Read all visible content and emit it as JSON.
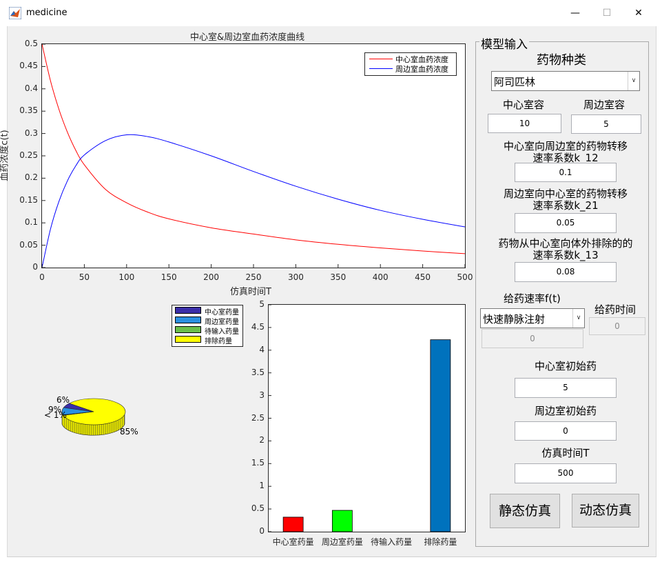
{
  "window": {
    "title": "medicine",
    "minimize_glyph": "—",
    "maximize_glyph": "☐",
    "close_glyph": "✕"
  },
  "concentration_chart": {
    "title": "中心室&周边室血药浓度曲线",
    "xlabel": "仿真时间T",
    "ylabel": "血药浓度c(t)",
    "xticks": [
      "0",
      "50",
      "100",
      "150",
      "200",
      "250",
      "300",
      "350",
      "400",
      "450",
      "500"
    ],
    "yticks": [
      "0",
      "0.05",
      "0.1",
      "0.15",
      "0.2",
      "0.25",
      "0.3",
      "0.35",
      "0.4",
      "0.45",
      "0.5"
    ],
    "legend": [
      "中心室血药浓度",
      "周边室血药浓度"
    ],
    "colors": [
      "#ff0000",
      "#0000ff"
    ]
  },
  "pie_chart": {
    "legend": [
      "中心室药量",
      "周边室药量",
      "待输入药量",
      "排除药量"
    ],
    "labels": [
      "6%",
      "9%",
      "< 1%",
      "85%"
    ],
    "colors": [
      "#3a2ea8",
      "#2a8fe0",
      "#6bbf4a",
      "#ffff00"
    ]
  },
  "bar_chart": {
    "categories": [
      "中心室药量",
      "周边室药量",
      "待输入药量",
      "排除药量"
    ],
    "yticks": [
      "0",
      "0.5",
      "1",
      "1.5",
      "2",
      "2.5",
      "3",
      "3.5",
      "4",
      "4.5",
      "5"
    ],
    "colors": [
      "#ff0000",
      "#00ff00",
      "#0000ff",
      "#0072bd"
    ]
  },
  "chart_data": [
    {
      "type": "line",
      "title": "中心室&周边室血药浓度曲线",
      "xlabel": "仿真时间T",
      "ylabel": "血药浓度c(t)",
      "xlim": [
        0,
        500
      ],
      "ylim": [
        0,
        0.5
      ],
      "x": [
        0,
        10,
        20,
        30,
        40,
        50,
        75,
        100,
        125,
        150,
        200,
        250,
        300,
        350,
        400,
        450,
        500
      ],
      "series": [
        {
          "name": "中心室血药浓度",
          "values": [
            0.5,
            0.418,
            0.354,
            0.303,
            0.262,
            0.23,
            0.175,
            0.145,
            0.124,
            0.109,
            0.089,
            0.075,
            0.062,
            0.052,
            0.044,
            0.037,
            0.031
          ]
        },
        {
          "name": "周边室血药浓度",
          "values": [
            0,
            0.086,
            0.148,
            0.194,
            0.228,
            0.252,
            0.284,
            0.297,
            0.293,
            0.281,
            0.25,
            0.215,
            0.182,
            0.153,
            0.128,
            0.108,
            0.091
          ]
        }
      ],
      "legend_position": "top-right"
    },
    {
      "type": "pie",
      "categories": [
        "中心室药量",
        "周边室药量",
        "待输入药量",
        "排除药量"
      ],
      "values": [
        6,
        9,
        0.5,
        84.5
      ],
      "labels": [
        "6%",
        "9%",
        "< 1%",
        "85%"
      ]
    },
    {
      "type": "bar",
      "categories": [
        "中心室药量",
        "周边室药量",
        "待输入药量",
        "排除药量"
      ],
      "values": [
        0.32,
        0.47,
        0,
        4.23
      ],
      "ylim": [
        0,
        5
      ]
    }
  ],
  "panel": {
    "title": "模型输入",
    "drug_type_label": "药物种类",
    "drug_type_value": "阿司匹林",
    "central_volume_label": "中心室容",
    "central_volume_value": "10",
    "peripheral_volume_label": "周边室容",
    "peripheral_volume_value": "5",
    "k12_label_line1": "中心室向周边室的药物转移",
    "k12_label_line2": "速率系数k_12",
    "k12_value": "0.1",
    "k21_label_line1": "周边室向中心室的药物转移",
    "k21_label_line2": "速率系数k_21",
    "k21_value": "0.05",
    "k13_label_line1": "药物从中心室向体外排除的的",
    "k13_label_line2": "速率系数k_13",
    "k13_value": "0.08",
    "dosing_rate_label": "给药速率f(t)",
    "dosing_mode_value": "快速静脉注射",
    "dosing_rate_value": "0",
    "dosing_time_label": "给药时间",
    "dosing_time_value": "0",
    "central_initial_label": "中心室初始药",
    "central_initial_value": "5",
    "peripheral_initial_label": "周边室初始药",
    "peripheral_initial_value": "0",
    "sim_time_label": "仿真时间T",
    "sim_time_value": "500",
    "static_sim_button": "静态仿真",
    "dynamic_sim_button": "动态仿真"
  }
}
